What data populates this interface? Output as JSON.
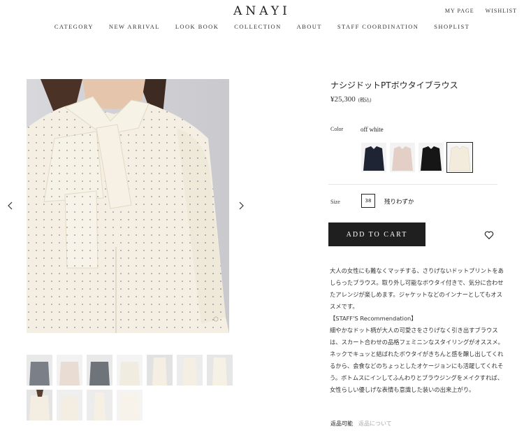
{
  "brand": {
    "logo": "ANAYI"
  },
  "util_nav": {
    "my_page": "MY PAGE",
    "wishlist": "WISHLIST"
  },
  "nav": [
    "CATEGORY",
    "NEW ARRIVAL",
    "LOOK BOOK",
    "COLLECTION",
    "ABOUT",
    "STAFF COORDINATION",
    "SHOPLIST"
  ],
  "product": {
    "name": "ナシジドットPTボウタイブラウス",
    "price": "¥25,300",
    "tax_note": "(税込)",
    "color_label": "Color",
    "color_value": "off white",
    "colors": [
      {
        "name": "navy",
        "hex": "#1e2433"
      },
      {
        "name": "pink",
        "hex": "#e4cfc6"
      },
      {
        "name": "black",
        "hex": "#161616"
      },
      {
        "name": "off white",
        "hex": "#f3ecdc",
        "selected": true
      }
    ],
    "size_label": "Size",
    "size": "38",
    "stock_note": "残りわずか",
    "add_to_cart": "ADD TO CART",
    "description": [
      "大人の女性にも難なくマッチする、さりげないドットプリントをあ",
      "しらったブラウス。取り外し可能なボウタイ付きで、気分に合わせ",
      "たアレンジが楽しめます。ジャケットなどのインナーとしてもオス",
      "スメです。",
      "【STAFF'S Recommendation】",
      "細やかなドット柄が大人の可愛さをさりげなく引き出すブラウス",
      "は、スカート合わせの品格フェミニンなスタイリングがオススメ。",
      "ネックでキュッと結ばれたボウタイがきちんと感を醸し出してくれ",
      "るから、会食などのちょっとしたオケージョンにも活躍してくれそ",
      "う。ボトムスにインしてふんわりとブラウジングをメイクすれば、",
      "女性らしい優しげな表情も意識した装いの出来上がり。"
    ],
    "returns_label": "返品可能",
    "returns_link": "返品について"
  },
  "colors": {
    "cart_button": "#1f1f1f",
    "blouse": "#f4efe2",
    "background": "#ffffff"
  }
}
